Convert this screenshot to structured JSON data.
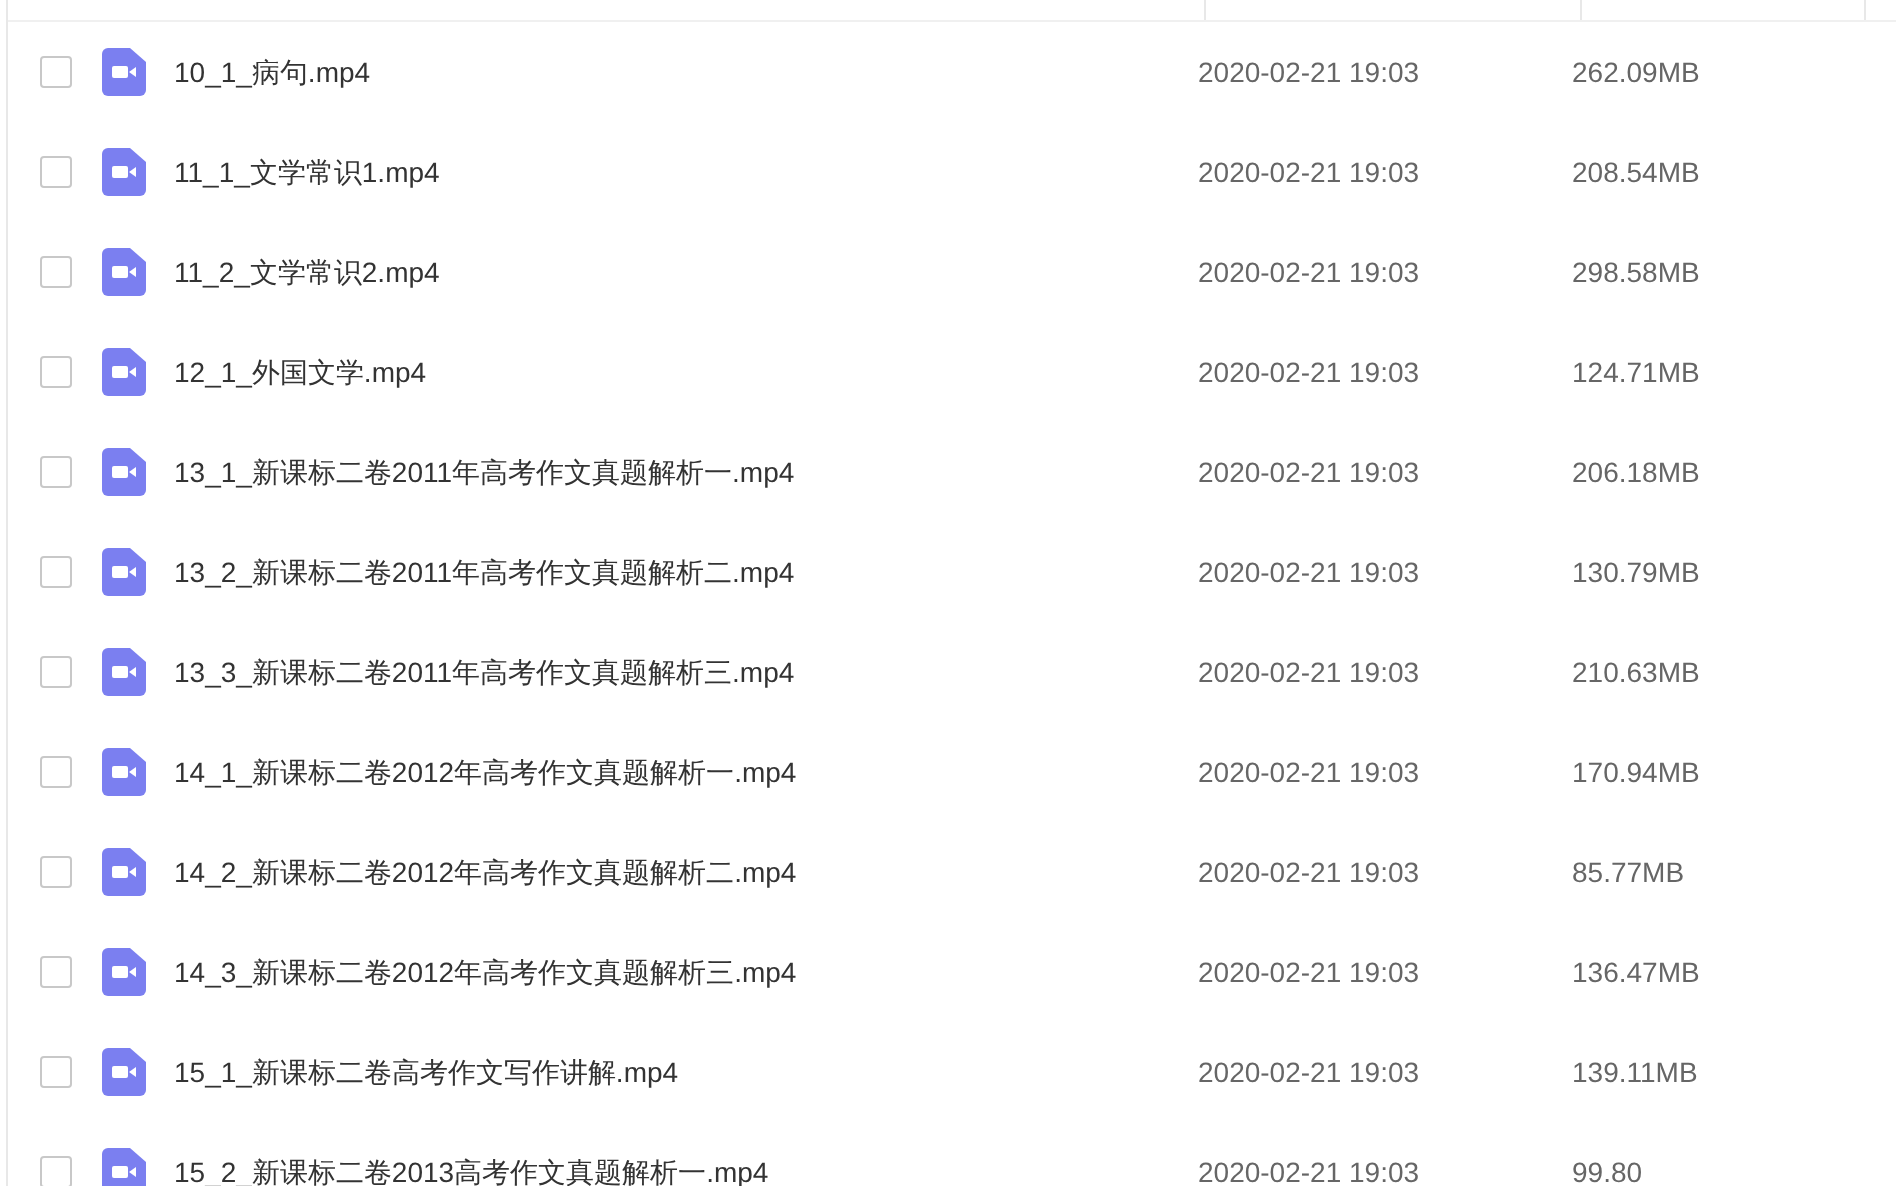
{
  "files": [
    {
      "name": "10_1_病句.mp4",
      "modified": "2020-02-21 19:03",
      "size": "262.09MB",
      "checked": false
    },
    {
      "name": "11_1_文学常识1.mp4",
      "modified": "2020-02-21 19:03",
      "size": "208.54MB",
      "checked": false
    },
    {
      "name": "11_2_文学常识2.mp4",
      "modified": "2020-02-21 19:03",
      "size": "298.58MB",
      "checked": false
    },
    {
      "name": "12_1_外国文学.mp4",
      "modified": "2020-02-21 19:03",
      "size": "124.71MB",
      "checked": false
    },
    {
      "name": "13_1_新课标二卷2011年高考作文真题解析一.mp4",
      "modified": "2020-02-21 19:03",
      "size": "206.18MB",
      "checked": false
    },
    {
      "name": "13_2_新课标二卷2011年高考作文真题解析二.mp4",
      "modified": "2020-02-21 19:03",
      "size": "130.79MB",
      "checked": false
    },
    {
      "name": "13_3_新课标二卷2011年高考作文真题解析三.mp4",
      "modified": "2020-02-21 19:03",
      "size": "210.63MB",
      "checked": false
    },
    {
      "name": "14_1_新课标二卷2012年高考作文真题解析一.mp4",
      "modified": "2020-02-21 19:03",
      "size": "170.94MB",
      "checked": false
    },
    {
      "name": "14_2_新课标二卷2012年高考作文真题解析二.mp4",
      "modified": "2020-02-21 19:03",
      "size": "85.77MB",
      "checked": false
    },
    {
      "name": "14_3_新课标二卷2012年高考作文真题解析三.mp4",
      "modified": "2020-02-21 19:03",
      "size": "136.47MB",
      "checked": false
    },
    {
      "name": "15_1_新课标二卷高考作文写作讲解.mp4",
      "modified": "2020-02-21 19:03",
      "size": "139.11MB",
      "checked": false
    },
    {
      "name": "15_2_新课标二卷2013高考作文真题解析一.mp4",
      "modified": "2020-02-21 19:03",
      "size": "99.80",
      "checked": false
    }
  ]
}
